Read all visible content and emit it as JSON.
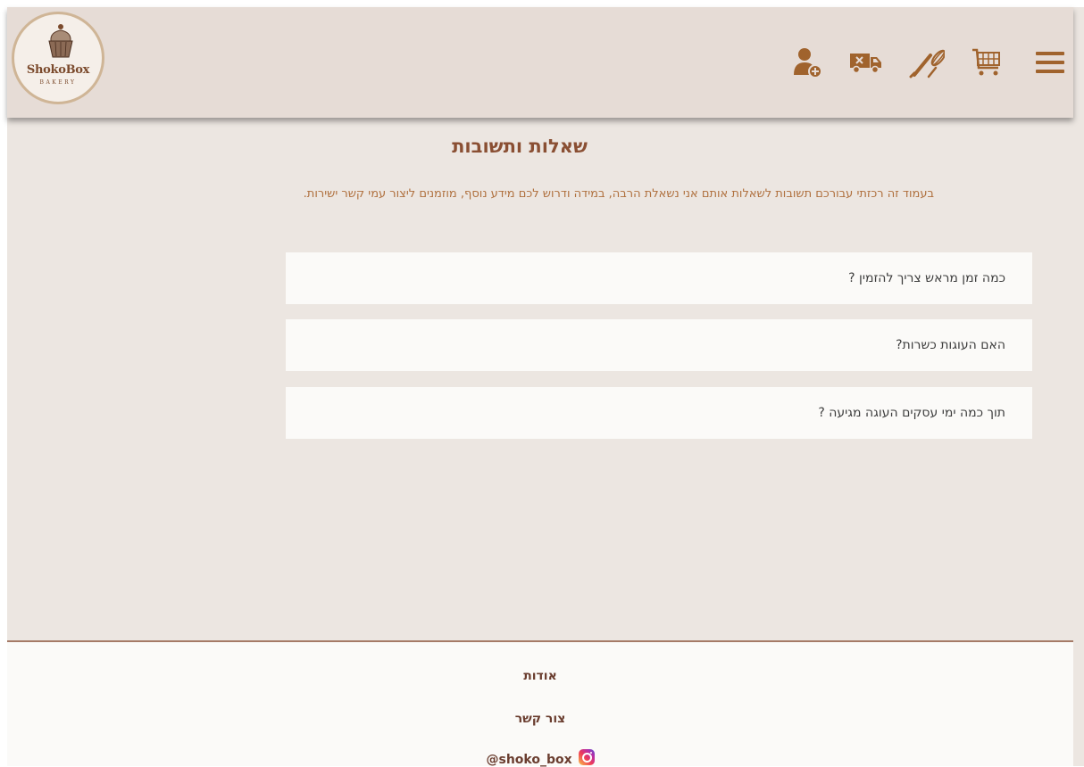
{
  "logo": {
    "name": "ShokoBox",
    "subtitle": "BAKERY"
  },
  "nav": {
    "icons": [
      "add-user-icon",
      "delivery-truck-icon",
      "whisk-rolling-pin-icon",
      "shopping-cart-icon",
      "hamburger-menu-icon"
    ]
  },
  "colors": {
    "accent": "#a0632d",
    "page_bg": "#ece6e1",
    "header_bg": "#e6dcd6",
    "title": "#8a4f33",
    "subtitle": "#b0713f",
    "card_bg": "#fbfaf8",
    "footer_border": "#a57a67"
  },
  "page": {
    "title": "שאלות ותשובות",
    "subtitle": "בעמוד זה רכזתי עבורכם תשובות לשאלות אותם אני נשאלת הרבה, במידה ודרוש לכם מידע נוסף, מוזמנים ליצור עמי קשר ישירות."
  },
  "faq": [
    {
      "question": "כמה זמן מראש צריך להזמין ?"
    },
    {
      "question": "האם העוגות כשרות?"
    },
    {
      "question": "תוך כמה ימי עסקים העוגה מגיעה ?"
    }
  ],
  "footer": {
    "about": "אודות",
    "contact": "צור קשר",
    "instagram": "@shoko_box"
  }
}
